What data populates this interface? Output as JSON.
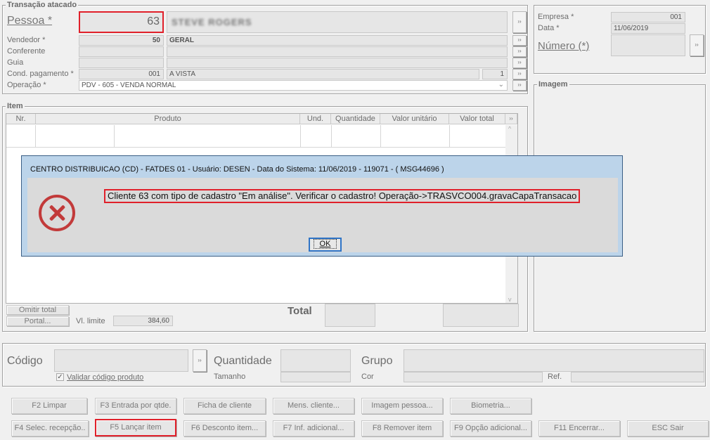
{
  "transacao": {
    "title": "Transação atacado",
    "pessoa_label": "Pessoa *",
    "pessoa_code": "63",
    "pessoa_name": "STEVE ROGERS",
    "vendedor_label": "Vendedor *",
    "vendedor_code": "50",
    "vendedor_name": "GERAL",
    "conferente_label": "Conferente",
    "guia_label": "Guia",
    "cond_label": "Cond. pagamento *",
    "cond_code": "001",
    "cond_name": "A VISTA",
    "cond_parcelas": "1",
    "operacao_label": "Operação *",
    "operacao_value": "PDV - 605 - VENDA NORMAL"
  },
  "empresa": {
    "empresa_label": "Empresa *",
    "empresa_value": "001",
    "data_label": "Data *",
    "data_value": "11/06/2019",
    "numero_label": "Número (*)"
  },
  "imagem": {
    "title": "Imagem"
  },
  "item": {
    "title": "Item",
    "columns": [
      "Nr.",
      "Produto",
      "Und.",
      "Quantidade",
      "Valor unitário",
      "Valor total"
    ],
    "omitir_total": "Omitir total",
    "portal": "Portal...",
    "vl_limite_label": "Vl. limite",
    "vl_limite_value": "384,60",
    "total_label": "Total"
  },
  "codigo": {
    "codigo_label": "Código",
    "quantidade_label": "Quantidade",
    "grupo_label": "Grupo",
    "validar_label": "Validar código produto",
    "tamanho_label": "Tamanho",
    "cor_label": "Cor",
    "ref_label": "Ref."
  },
  "buttons": {
    "row1": [
      "F2 Limpar",
      "F3 Entrada por qtde.",
      "Ficha de cliente",
      "Mens. cliente...",
      "Imagem pessoa...",
      "Biometria..."
    ],
    "row2": [
      "F4 Selec. recepção..",
      "F5 Lançar item",
      "F6 Desconto item...",
      "F7 Inf. adicional...",
      "F8 Remover item",
      "F9 Opção adicional...",
      "F11 Encerrar...",
      "ESC Sair"
    ]
  },
  "dialog": {
    "title": "CENTRO DISTRIBUICAO (CD) - FATDES 01 - Usuário: DESEN - Data do Sistema: 11/06/2019 - 119071 - ( MSG44696 )",
    "message": "Cliente 63 com tipo de cadastro \"Em análise\". Verificar o cadastro! Operação->TRASVCO004.gravaCapaTransacao",
    "ok_label": "OK",
    "icon": "error-icon"
  },
  "colors": {
    "highlight": "#e0202a",
    "error": "#c23a3a",
    "dialog_frame": "#bcd4ea"
  }
}
